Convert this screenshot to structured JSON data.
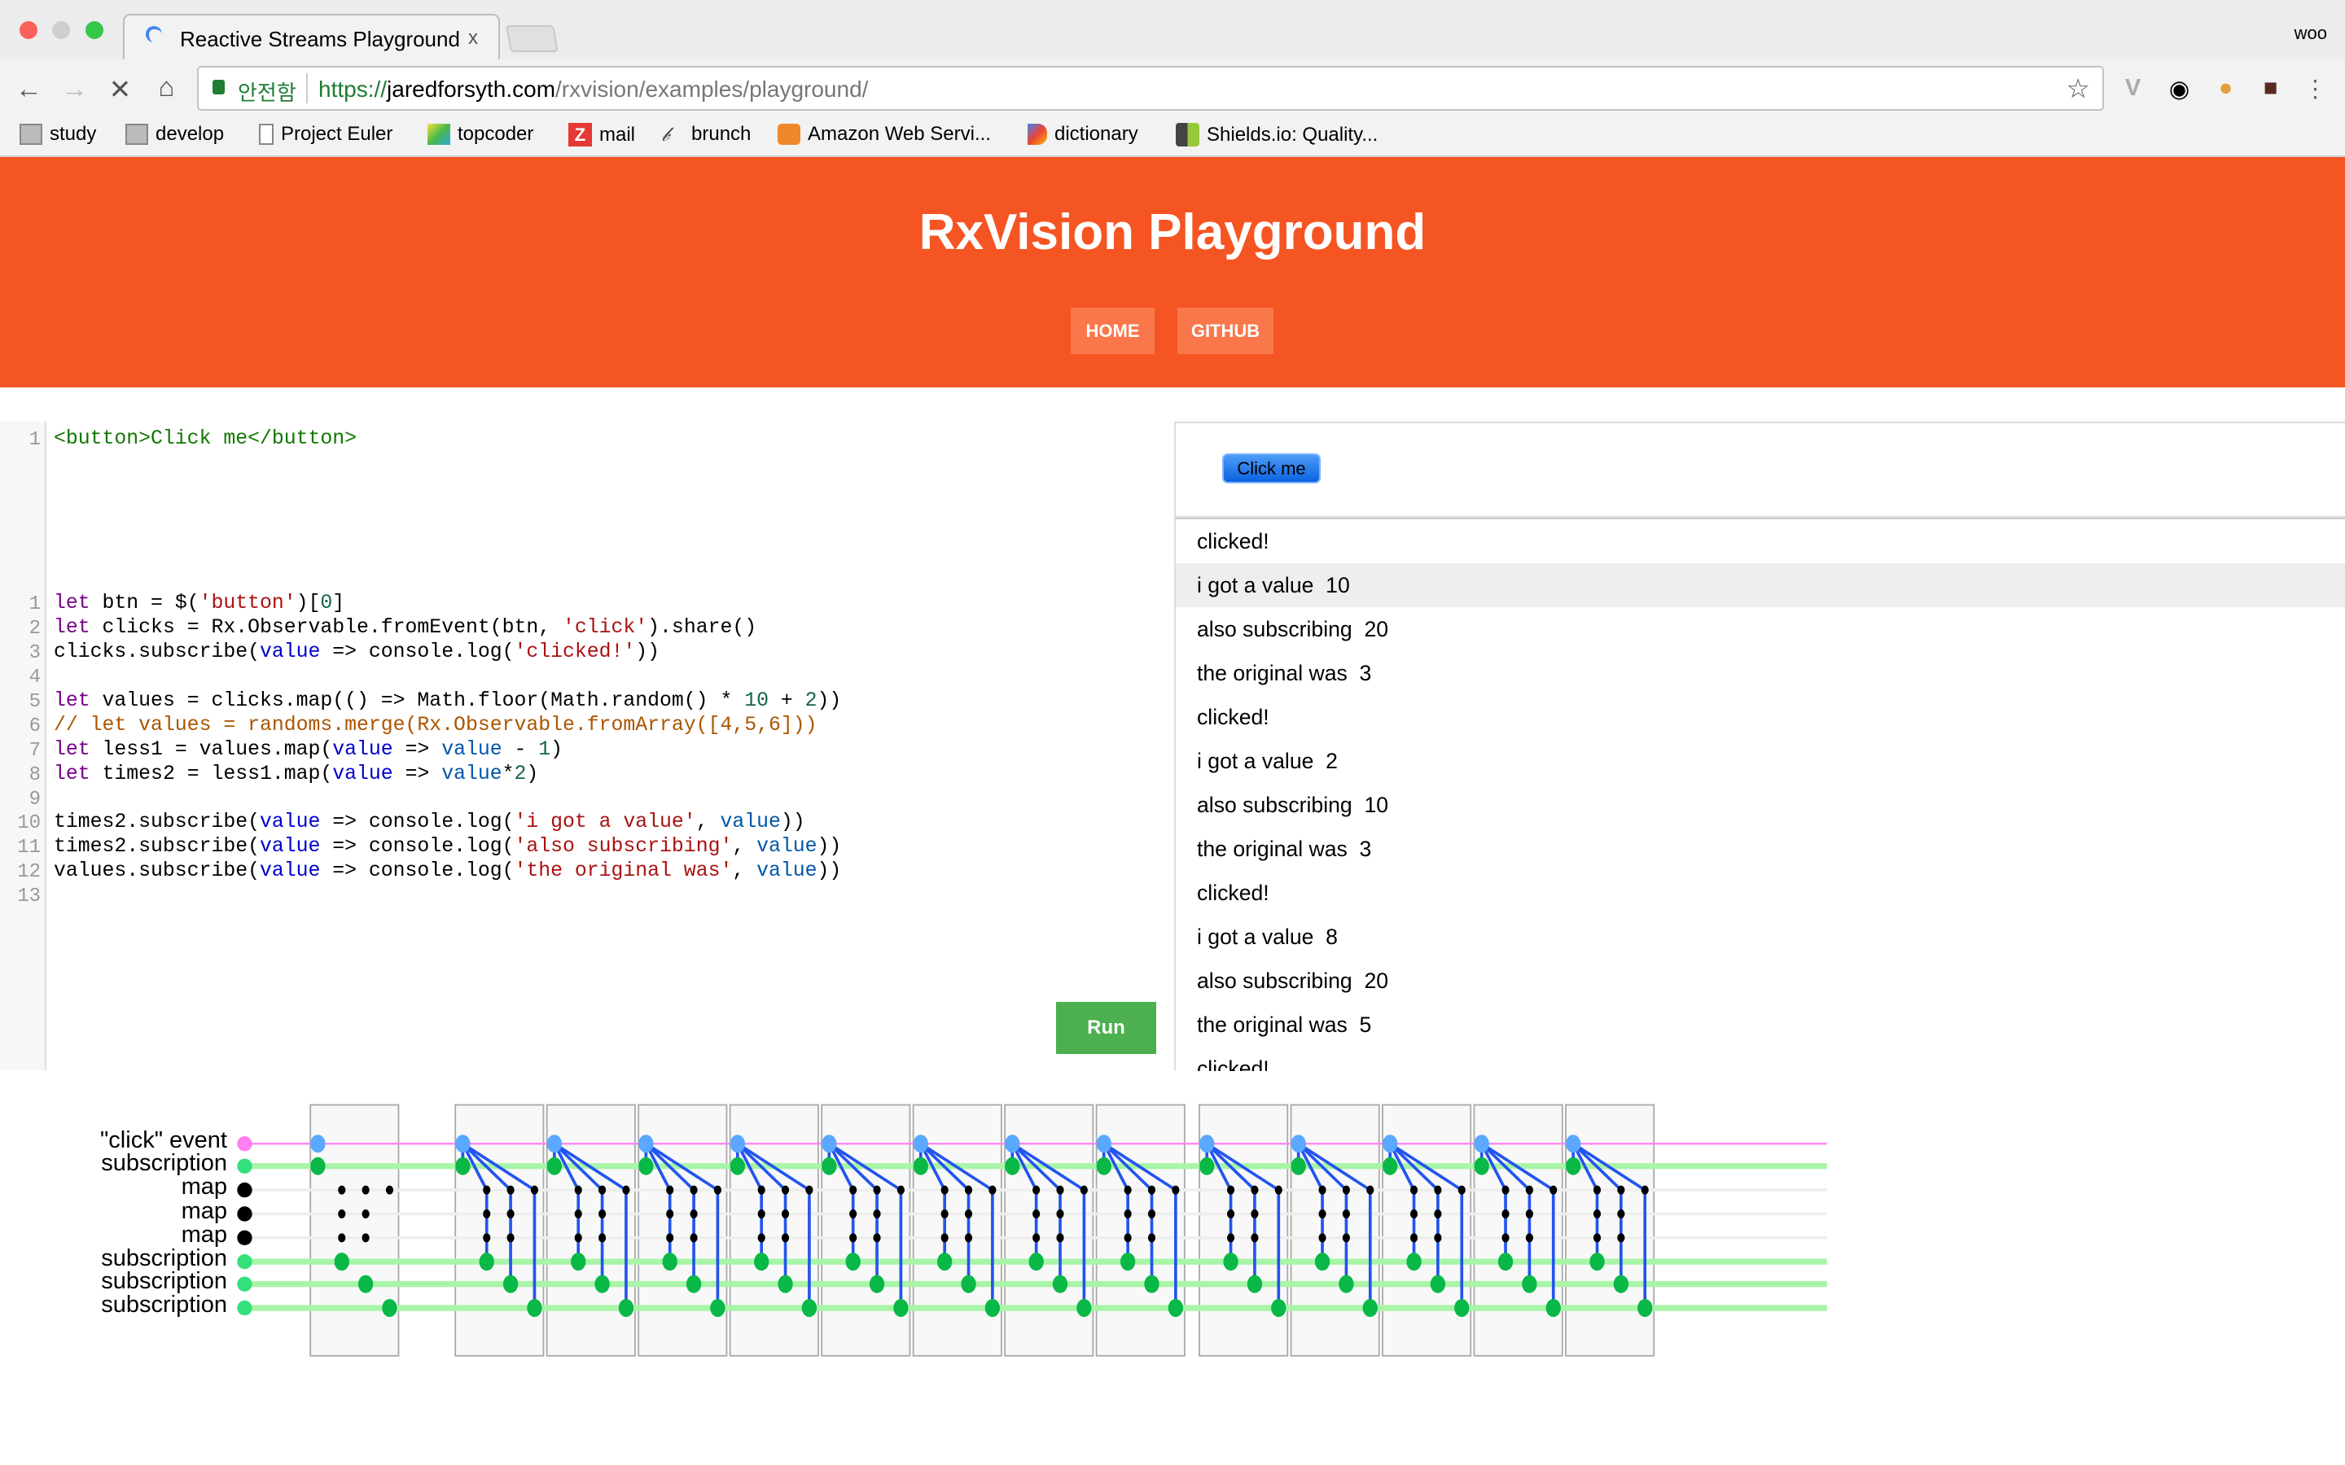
{
  "browser": {
    "tab_title": "Reactive Streams Playground",
    "tab_close": "x",
    "profile": "woo",
    "security_label": "안전함",
    "url_scheme": "https://",
    "url_host": "jaredforsyth.com",
    "url_path": "/rxvision/examples/playground/",
    "bookmarks": [
      "study",
      "develop",
      "Project Euler",
      "topcoder",
      "mail",
      "brunch",
      "Amazon Web Servi...",
      "dictionary",
      "Shields.io: Quality..."
    ]
  },
  "page": {
    "title": "RxVision Playground",
    "nav": [
      "HOME",
      "GITHUB"
    ],
    "run_label": "Run",
    "html_editor": {
      "lines": [
        "<button>Click me</button>"
      ]
    },
    "preview_button": "Click me",
    "log": [
      "clicked!",
      "i got a value  10",
      "also subscribing  20",
      "the original was  3",
      "clicked!",
      "i got a value  2",
      "also subscribing  10",
      "the original was  3",
      "clicked!",
      "i got a value  8",
      "also subscribing  20",
      "the original was  5",
      "clicked!"
    ]
  },
  "diagram": {
    "rows": [
      "\"click\" event",
      "subscription",
      "map",
      "map",
      "map",
      "subscription",
      "subscription",
      "subscription"
    ],
    "initial_boxes": 1,
    "click_events": 13,
    "colors": {
      "event": "#ff7ff2",
      "subscription_line": "#a8f5a8",
      "subscription_dot": "#09b846",
      "emit": "#5aa8ff",
      "link": "#2255ee",
      "map": "#000000"
    }
  }
}
